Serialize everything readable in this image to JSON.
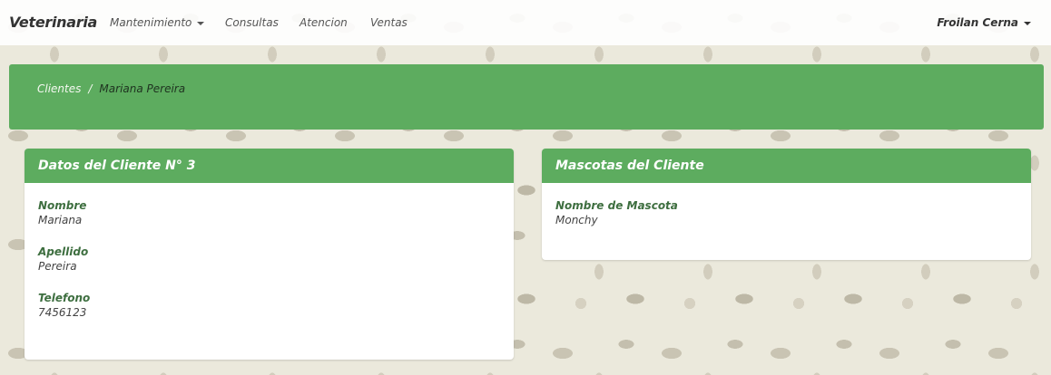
{
  "navbar": {
    "brand": "Veterinaria",
    "items": [
      {
        "label": "Mantenimiento",
        "dropdown": true
      },
      {
        "label": "Consultas"
      },
      {
        "label": "Atencion"
      },
      {
        "label": "Ventas"
      }
    ],
    "user": "Froilan Cerna"
  },
  "breadcrumb": {
    "parent": "Clientes",
    "separator": "/",
    "current": "Mariana Pereira"
  },
  "cliente_panel": {
    "title": "Datos del Cliente N° 3",
    "fields": [
      {
        "label": "Nombre",
        "value": "Mariana"
      },
      {
        "label": "Apellido",
        "value": "Pereira"
      },
      {
        "label": "Telefono",
        "value": "7456123"
      }
    ]
  },
  "mascotas_panel": {
    "title": "Mascotas del Cliente",
    "fields": [
      {
        "label": "Nombre de Mascota",
        "value": "Monchy"
      }
    ]
  },
  "colors": {
    "accent_green": "#5dac5f",
    "label_green": "#3d6e3f"
  },
  "icons": {
    "dropdown": "caret-down-icon"
  }
}
